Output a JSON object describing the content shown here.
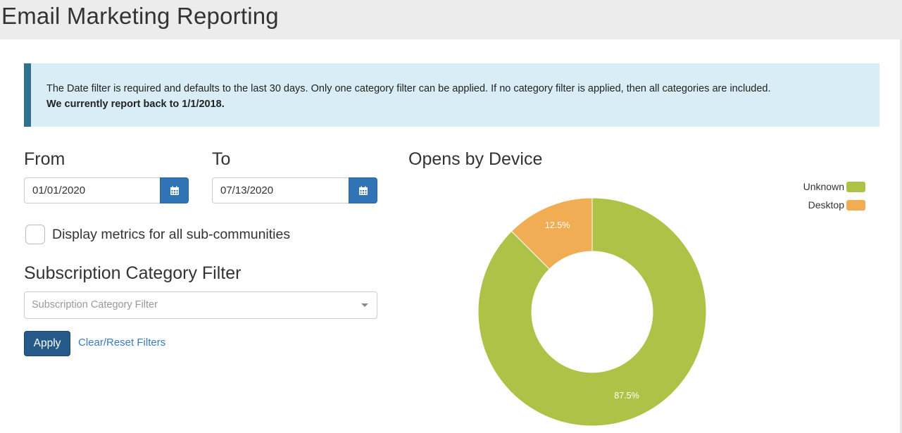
{
  "header": {
    "title": "Email Marketing Reporting"
  },
  "alert": {
    "message": "The Date filter is required and defaults to the last 30 days. Only one category filter can be applied. If no category filter is applied, then all categories are included.",
    "bold_message": "We currently report back to 1/1/2018."
  },
  "filters": {
    "from_label": "From",
    "from_value": "01/01/2020",
    "to_label": "To",
    "to_value": "07/13/2020",
    "sub_communities_label": "Display metrics for all sub-communities",
    "sub_communities_checked": false,
    "category_heading": "Subscription Category Filter",
    "category_placeholder": "Subscription Category Filter",
    "apply_label": "Apply",
    "reset_label": "Clear/Reset Filters"
  },
  "icons": {
    "calendar": "calendar-icon",
    "dropdown": "caret-down-icon"
  },
  "colors": {
    "accent": "#3074b5",
    "apply": "#265a88",
    "alert_bg": "#d9edf7",
    "alert_border": "#31708f"
  },
  "chart_data": {
    "type": "pie",
    "title": "Opens by Device",
    "categories": [
      "Unknown",
      "Desktop"
    ],
    "values": [
      87.5,
      12.5
    ],
    "labels": [
      "87.5%",
      "12.5%"
    ],
    "colors": [
      "#aec248",
      "#f0ad54"
    ],
    "donut": true,
    "legend": "top-right"
  }
}
